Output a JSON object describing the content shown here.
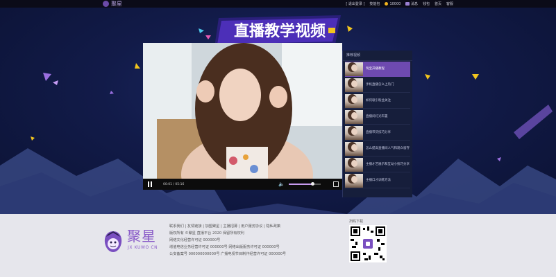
{
  "brand": {
    "name": "聚星",
    "sub": "JX KUWO CN"
  },
  "topnav": {
    "items": [
      "[ 退出登录 ]",
      "技能包",
      "10000",
      "消息",
      "钱包",
      "首页",
      "客服"
    ]
  },
  "banner": {
    "title": "直播教学视频"
  },
  "player": {
    "time": "00:01 / 05:16",
    "progress": 0.02,
    "volume": 0.75
  },
  "list": {
    "header": "推荐视频",
    "items": [
      "淘宝开播教程",
      "手机直播怎么上热门",
      "如何吸引粉丝关注",
      "直播间灯光布置",
      "直播带货技巧分享",
      "怎么提高直播间人气和观众留存",
      "主播才艺展示和互动小技巧分享",
      "主播口才训练方法"
    ]
  },
  "footer": {
    "lines": [
      "联系我们 | 友情链接 | 加盟聚星 | 主播招募 | 用户服务协议 | 隐私政策",
      "版权所有 ©聚星 直播平台 2020 保留所有权利",
      "网络文化经营许可证 000000号",
      "增值电信业务经营许可证 000000号  网络出版服务许可证 000000号",
      "公安备案号 000000000000号  广播电视节目制作经营许可证 000000号"
    ],
    "qr_label": "扫码下载"
  },
  "colors": {
    "accent": "#8a5cc8",
    "bg": "#121b49"
  }
}
